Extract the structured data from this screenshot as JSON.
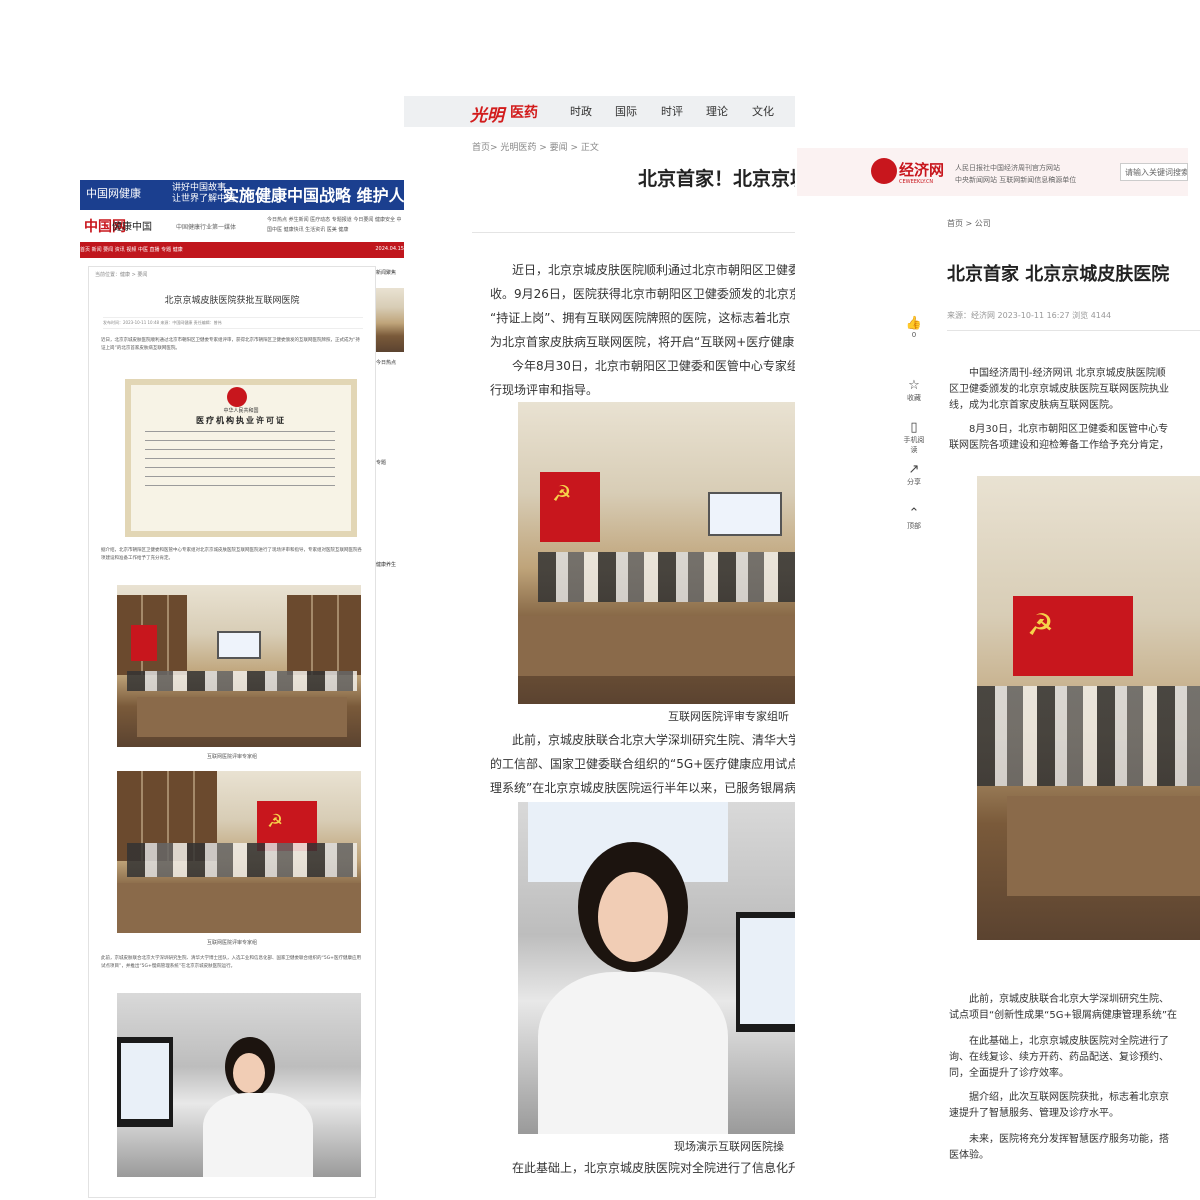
{
  "panelA": {
    "banner_logo": "中国网健康",
    "banner_slogan_1": "讲好中国故事",
    "banner_slogan_2": "让世界了解中国",
    "banner_big": "实施健康中国战略  维护人",
    "brand": "中国网",
    "brand_sub": "健康中国",
    "tagline": "中国健康行业第一媒体",
    "links": "今日热点  养生新闻  医疗动态  专题报道  今日要闻  健康安全  中国中医  健康快讯  生活资讯  医美  健康",
    "nav_items": "首页  新闻  要闻  资讯  视频  中医  直播  专题  健康",
    "date": "2024.04.15",
    "breadcrumb": "当前位置：健康 > 要闻",
    "title": "北京京城皮肤医院获批互联网医院",
    "meta": "发布时间：2023-10-11 10:48  来源：中国网健康  责任编辑：曾伟",
    "para1": "近日，北京京城皮肤医院顺利通过北京市朝阳区卫健委专家组评审，获得北京市朝阳区卫健委颁发的互联网医院牌照，正式成为“持证上岗”的北京首家皮肤病互联网医院。",
    "license_title": "中华人民共和国",
    "license_title2": "医疗机构执业许可证",
    "para2": "据介绍，北京市朝阳区卫健委和医管中心专家组对北京京城皮肤医院互联网医院进行了现场评审和指导，专家组对医院互联网医院各项建设和准备工作给予了充分肯定。",
    "cap1": "互联网医院评审专家组",
    "cap2": "互联网医院评审专家组",
    "para3": "此前，京城皮肤联合北京大学深圳研究生院、清华大学博士团队，入选工业和信息化部、国家卫健委联合组织的“5G+医疗健康应用试点项目”，并推出“5G+慢病管理系统”在北京京城皮肤医院运行。",
    "side_blocks": [
      "新闻聚焦",
      "今日热点",
      "专题",
      "健康养生"
    ]
  },
  "panelB": {
    "logo": "光明",
    "logo2": "医药",
    "nav": [
      "时政",
      "国际",
      "时评",
      "理论",
      "文化"
    ],
    "breadcrumb": "首页> 光明医药 > 要闻 > 正文",
    "title": "北京首家！北京京城",
    "lines": [
      "近日，北京京城皮肤医院顺利通过北京市朝阳区卫健委",
      "收。9月26日，医院获得北京市朝阳区卫健委颁发的北京京",
      "“持证上岗”、拥有互联网医院牌照的医院，这标志着北京",
      "为北京首家皮肤病互联网医院，将开启“互联网+医疗健康",
      "今年8月30日，北京市朝阳区卫健委和医管中心专家组",
      "行现场评审和指导。"
    ],
    "cap1": "互联网医院评审专家组听",
    "lines2": [
      "此前，京城皮肤联合北京大学深圳研究生院、清华大学",
      "的工信部、国家卫健委联合组织的“5G+医疗健康应用试点",
      "理系统”在北京京城皮肤医院运行半年以来，已服务银屑病"
    ],
    "cap2": "现场演示互联网医院操",
    "line3": "在此基础上，北京京城皮肤医院对全院进行了信息化升"
  },
  "panelC": {
    "site_name": "经济网",
    "site_en": "CEWEEKLY.CN",
    "info1": "人民日报社中国经济周刊官方网站",
    "info2": "中央新闻网站  互联网新闻信息稿源单位",
    "search_placeholder": "请输入关键词搜索",
    "breadcrumb": "首页  >  公司",
    "title": "北京首家 北京京城皮肤医院",
    "meta": "来源：经济网    2023-10-11 16:27    浏览 4144",
    "tools": [
      {
        "icon": "👍",
        "label": "0"
      },
      {
        "icon": "☆",
        "label": "收藏"
      },
      {
        "icon": "▯",
        "label": "手机阅读"
      },
      {
        "icon": "↗",
        "label": "分享"
      },
      {
        "icon": "⌃",
        "label": "顶部"
      }
    ],
    "p1": [
      "中国经济周刊-经济网讯 北京京城皮肤医院顺",
      "区卫健委颁发的北京京城皮肤医院互联网医院执业",
      "线，成为北京首家皮肤病互联网医院。"
    ],
    "p2": [
      "8月30日，北京市朝阳区卫健委和医管中心专",
      "联网医院各项建设和迎检筹备工作给予充分肯定，"
    ],
    "p3": [
      "此前，京城皮肤联合北京大学深圳研究生院、",
      "试点项目“创新性成果“5G+银屑病健康管理系统”在"
    ],
    "p4": [
      "在此基础上，北京京城皮肤医院对全院进行了",
      "询、在线复诊、续方开药、药品配送、复诊预约、",
      "同，全面提升了诊疗效率。"
    ],
    "p5": [
      "据介绍，此次互联网医院获批，标志着北京京",
      "速提升了智慧服务、管理及诊疗水平。"
    ],
    "p6": [
      "未来，医院将充分发挥智慧医疗服务功能，搭",
      "医体验。"
    ]
  },
  "colors": {
    "red": "#c8161d",
    "navy": "#1b3f8f"
  }
}
